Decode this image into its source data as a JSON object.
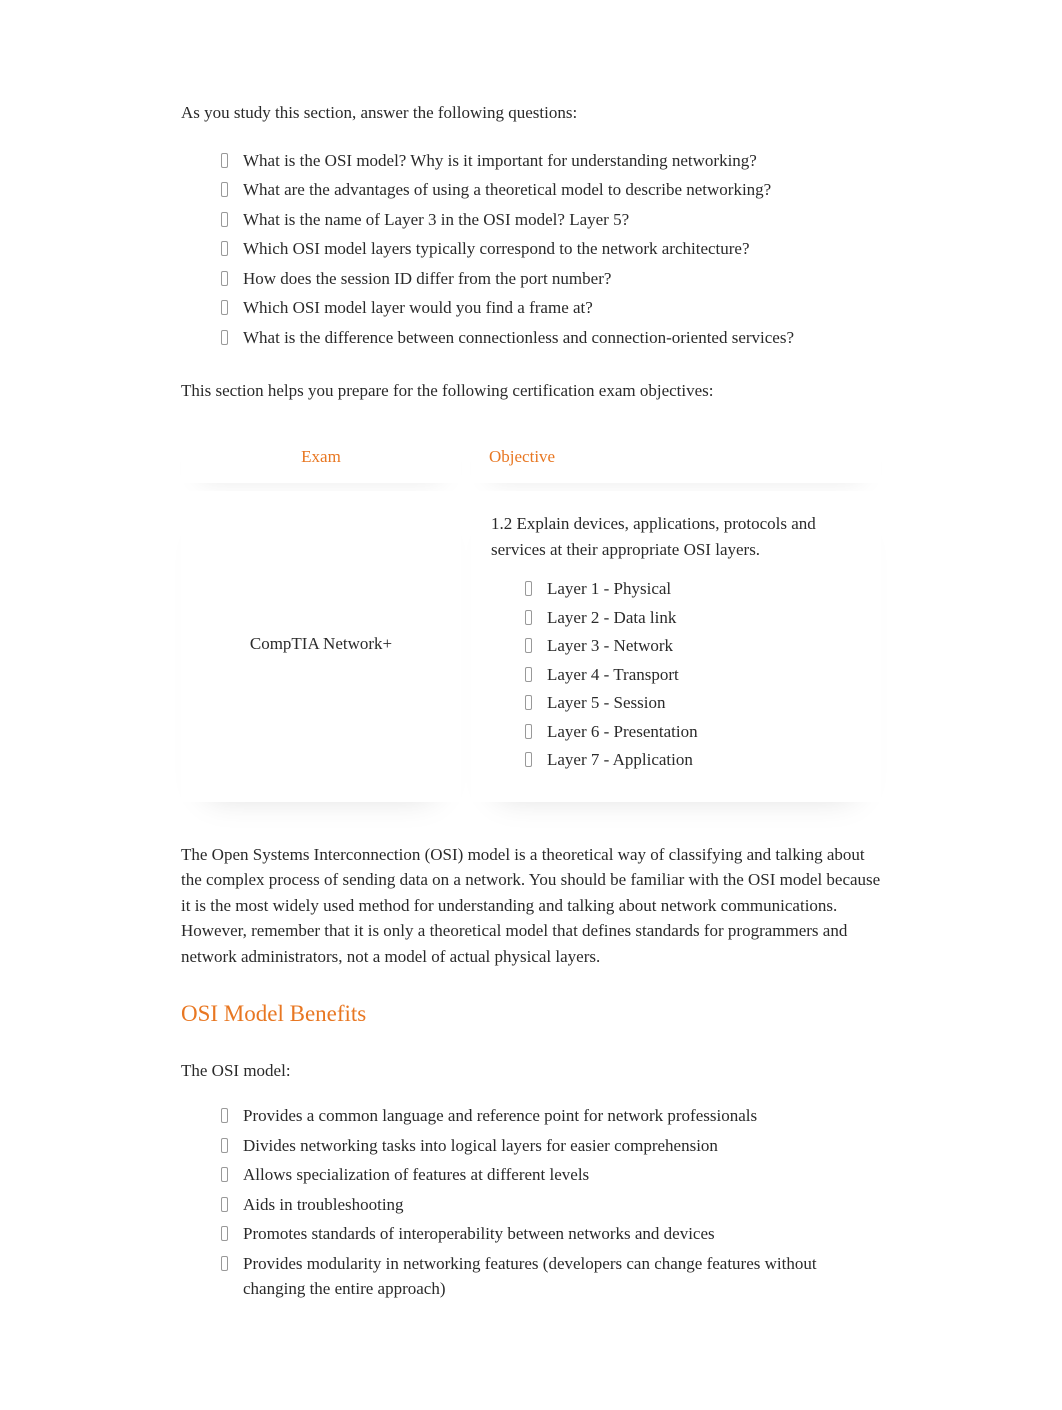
{
  "intro": "As you study this section, answer the following questions:",
  "questions": [
    "What is the OSI model? Why is it important for understanding networking?",
    "What are the advantages of using a theoretical model to describe networking?",
    "What is the name of Layer 3 in the OSI model? Layer 5?",
    "Which OSI model layers typically correspond to the network architecture?",
    "How does the session ID differ from the port number?",
    "Which OSI model layer would you find a frame at?",
    "What is the difference between connectionless and connection-oriented services?"
  ],
  "prep_text": "This section helps you prepare for the following certification exam objectives:",
  "table": {
    "header_left": "Exam",
    "header_right": "Objective",
    "exam_name": "CompTIA Network+",
    "objective_intro": "1.2 Explain devices, applications, protocols and services at their appropriate OSI layers.",
    "layers": [
      "Layer 1 - Physical",
      "Layer 2 - Data link",
      "Layer 3 - Network",
      "Layer 4 - Transport",
      "Layer 5 - Session",
      "Layer 6 - Presentation",
      "Layer 7 - Application"
    ]
  },
  "body_para": "The Open Systems Interconnection (OSI) model is a theoretical way of classifying and talking about the complex process of sending data on a network. You should be familiar with the OSI model because it is the most widely used method for understanding and talking about network communications. However, remember that it is only a theoretical model that defines standards for programmers and network administrators, not a model of actual physical layers.",
  "benefits_heading": "OSI Model Benefits",
  "benefits_intro": "The OSI model:",
  "benefits": [
    "Provides a common language and reference point for network professionals",
    "Divides networking tasks into logical layers for easier comprehension",
    "Allows specialization of features at different levels",
    "Aids in troubleshooting",
    "Promotes standards of interoperability between networks and devices",
    "Provides modularity in networking features (developers can change features without changing the entire approach)"
  ]
}
